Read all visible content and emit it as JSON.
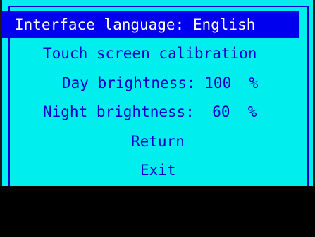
{
  "menu": {
    "items": [
      {
        "label": "Interface language: English",
        "selected": true
      },
      {
        "label": "Touch screen calibration",
        "selected": false
      },
      {
        "label": "Day brightness: 100  %",
        "selected": false
      },
      {
        "label": "Night brightness:  60  %",
        "selected": false
      },
      {
        "label": "Return",
        "selected": false
      },
      {
        "label": "Exit",
        "selected": false
      }
    ]
  },
  "colors": {
    "background": "#00eeee",
    "text": "#0000cc",
    "highlight_bg": "#0000ee",
    "highlight_text": "#ffffff"
  }
}
